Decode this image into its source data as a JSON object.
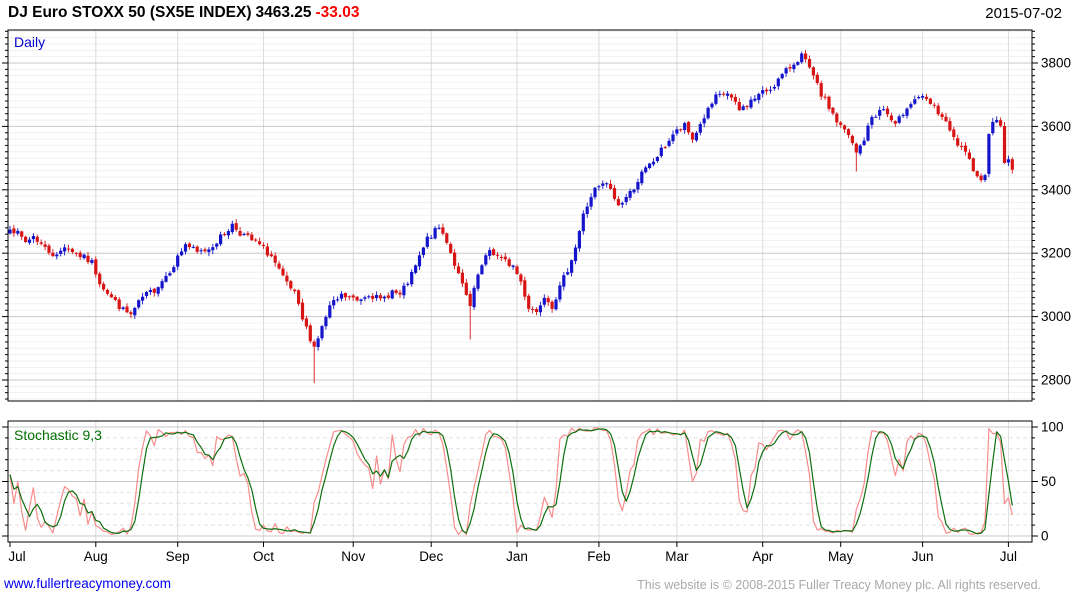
{
  "header": {
    "title": "DJ Euro STOXX 50 (SX5E INDEX)",
    "price": "3463.25",
    "change": "-33.03",
    "date": "2015-07-02"
  },
  "main_chart": {
    "label": "Daily"
  },
  "stochastic": {
    "label": "Stochastic 9,3"
  },
  "footer": {
    "website": "www.fullertreacymoney.com",
    "copyright": "This website is © 2008-2015 Fuller Treacy Money plc. All rights reserved."
  },
  "colors": {
    "up_candle": "#1414cc",
    "down_candle": "#d81414",
    "k_line": "#f98c8c",
    "d_line": "#0e6f0e",
    "grid_major": "#c8c8c8",
    "grid_minor": "#f0f0f0",
    "grid_dashed": "#e0e0e0",
    "month_line": "#dcdcdc",
    "border": "#000000",
    "daily_label": "#0000cc",
    "stoch_label": "#007000",
    "change_red": "#ff0000",
    "link_blue": "#0000ee",
    "copyright_gray": "#a9a9a9"
  },
  "chart_data": [
    {
      "type": "candlestick",
      "title": "DJ Euro STOXX 50 (SX5E INDEX)",
      "period": "Daily",
      "last_close": 3463.25,
      "change": -33.03,
      "ylabel": "",
      "ylim": [
        2733,
        3904
      ],
      "y_ticks": [
        2800,
        3000,
        3200,
        3400,
        3600,
        3800
      ],
      "y_minor_step": 20,
      "x_labels": [
        "Jul",
        "Aug",
        "Sep",
        "Oct",
        "Nov",
        "Dec",
        "Jan",
        "Feb",
        "Mar",
        "Apr",
        "May",
        "Jun",
        "Jul"
      ],
      "trading_days": 258,
      "month_start_days": [
        0,
        22,
        43,
        65,
        88,
        108,
        130,
        151,
        171,
        193,
        213,
        234,
        256
      ],
      "close_anchors": [
        [
          0,
          3285
        ],
        [
          2,
          3260
        ],
        [
          4,
          3235
        ],
        [
          6,
          3255
        ],
        [
          9,
          3215
        ],
        [
          12,
          3190
        ],
        [
          14,
          3225
        ],
        [
          17,
          3200
        ],
        [
          21,
          3170
        ],
        [
          23,
          3110
        ],
        [
          26,
          3060
        ],
        [
          29,
          3020
        ],
        [
          31,
          3005
        ],
        [
          34,
          3060
        ],
        [
          37,
          3085
        ],
        [
          40,
          3130
        ],
        [
          42,
          3165
        ],
        [
          45,
          3230
        ],
        [
          48,
          3200
        ],
        [
          51,
          3215
        ],
        [
          54,
          3250
        ],
        [
          57,
          3290
        ],
        [
          59,
          3265
        ],
        [
          62,
          3240
        ],
        [
          64,
          3225
        ],
        [
          67,
          3190
        ],
        [
          70,
          3120
        ],
        [
          73,
          3070
        ],
        [
          75,
          2990
        ],
        [
          78,
          2905
        ],
        [
          80,
          2965
        ],
        [
          82,
          3030
        ],
        [
          85,
          3065
        ],
        [
          87,
          3060
        ],
        [
          89,
          3050
        ],
        [
          92,
          3075
        ],
        [
          95,
          3050
        ],
        [
          98,
          3080
        ],
        [
          100,
          3065
        ],
        [
          103,
          3130
        ],
        [
          106,
          3215
        ],
        [
          107,
          3245
        ],
        [
          110,
          3280
        ],
        [
          112,
          3240
        ],
        [
          115,
          3130
        ],
        [
          118,
          3030
        ],
        [
          120,
          3130
        ],
        [
          123,
          3210
        ],
        [
          126,
          3180
        ],
        [
          129,
          3160
        ],
        [
          131,
          3110
        ],
        [
          133,
          3030
        ],
        [
          135,
          3015
        ],
        [
          137,
          3070
        ],
        [
          139,
          3035
        ],
        [
          141,
          3090
        ],
        [
          143,
          3150
        ],
        [
          145,
          3220
        ],
        [
          147,
          3320
        ],
        [
          149,
          3380
        ],
        [
          150,
          3400
        ],
        [
          153,
          3420
        ],
        [
          156,
          3350
        ],
        [
          159,
          3390
        ],
        [
          162,
          3450
        ],
        [
          165,
          3490
        ],
        [
          168,
          3540
        ],
        [
          170,
          3575
        ],
        [
          173,
          3600
        ],
        [
          175,
          3560
        ],
        [
          178,
          3630
        ],
        [
          181,
          3690
        ],
        [
          184,
          3705
        ],
        [
          187,
          3650
        ],
        [
          190,
          3680
        ],
        [
          192,
          3700
        ],
        [
          195,
          3720
        ],
        [
          198,
          3760
        ],
        [
          201,
          3800
        ],
        [
          203,
          3825
        ],
        [
          205,
          3780
        ],
        [
          208,
          3700
        ],
        [
          211,
          3640
        ],
        [
          212,
          3615
        ],
        [
          215,
          3570
        ],
        [
          217,
          3515
        ],
        [
          219,
          3560
        ],
        [
          221,
          3630
        ],
        [
          224,
          3655
        ],
        [
          227,
          3600
        ],
        [
          230,
          3665
        ],
        [
          233,
          3695
        ],
        [
          236,
          3670
        ],
        [
          239,
          3630
        ],
        [
          242,
          3560
        ],
        [
          245,
          3510
        ],
        [
          248,
          3450
        ],
        [
          249,
          3425
        ],
        [
          250,
          3455
        ],
        [
          251,
          3585
        ],
        [
          253,
          3625
        ],
        [
          254,
          3600
        ],
        [
          255,
          3490
        ],
        [
          256,
          3496.28
        ],
        [
          257,
          3463.25
        ]
      ],
      "exact_closes": {
        "256": 3496.28,
        "257": 3463.25
      },
      "wick_overrides": {
        "31": {
          "low": 2995
        },
        "78": {
          "low": 2790
        },
        "118": {
          "low": 2928
        },
        "203": {
          "high": 3836
        },
        "217": {
          "low": 3458
        }
      }
    },
    {
      "type": "line",
      "title": "Stochastic 9,3",
      "stochastic_period": 9,
      "smoothing": 3,
      "derived_from": "candlestick OHLC above",
      "series": [
        {
          "name": "%K fast stochastic",
          "color": "#f98c8c"
        },
        {
          "name": "%D smoothed stochastic",
          "color": "#0e6f0e"
        }
      ],
      "ylim": [
        0,
        100
      ],
      "y_ticks": [
        0,
        50,
        100
      ],
      "y_minor_step": 10,
      "grid": "dashed minors, solid at 0/50/100"
    }
  ]
}
